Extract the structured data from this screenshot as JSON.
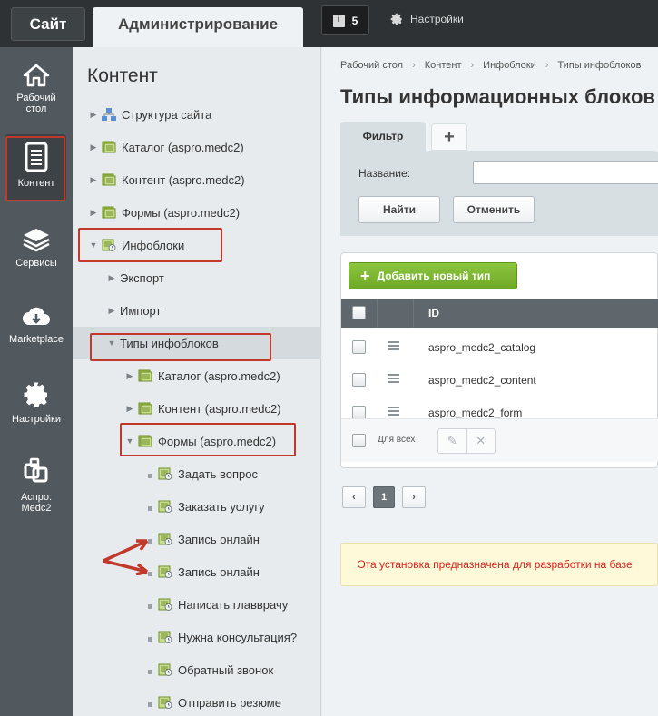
{
  "topbar": {
    "site_label": "Сайт",
    "admin_label": "Администрирование",
    "notifications_count": "5",
    "settings_label": "Настройки"
  },
  "leftnav": {
    "items": [
      {
        "label": "Рабочий стол",
        "icon": "home-icon"
      },
      {
        "label": "Контент",
        "icon": "document-icon",
        "active": true
      },
      {
        "label": "Сервисы",
        "icon": "layers-icon"
      },
      {
        "label": "Marketplace",
        "icon": "cloud-download-icon"
      },
      {
        "label": "Настройки",
        "icon": "gear-icon"
      },
      {
        "label": "Аспро: Medc2",
        "icon": "aspro-logo-icon"
      }
    ]
  },
  "tree": {
    "title": "Контент",
    "rows": [
      {
        "label": "Структура сайта"
      },
      {
        "label": "Каталог (aspro.medc2)"
      },
      {
        "label": "Контент (aspro.medc2)"
      },
      {
        "label": "Формы (aspro.medc2)"
      },
      {
        "label": "Инфоблоки"
      },
      {
        "label": "Экспорт"
      },
      {
        "label": "Импорт"
      },
      {
        "label": "Типы инфоблоков"
      },
      {
        "label": "Каталог (aspro.medc2)"
      },
      {
        "label": "Контент (aspro.medc2)"
      },
      {
        "label": "Формы (aspro.medc2)"
      },
      {
        "label": "Задать вопрос"
      },
      {
        "label": "Заказать услугу"
      },
      {
        "label": "Запись онлайн"
      },
      {
        "label": "Запись онлайн"
      },
      {
        "label": "Написать главврачу"
      },
      {
        "label": "Нужна консультация?"
      },
      {
        "label": "Обратный звонок"
      },
      {
        "label": "Отправить резюме"
      }
    ]
  },
  "main": {
    "breadcrumbs": [
      "Рабочий стол",
      "Контент",
      "Инфоблоки",
      "Типы инфоблоков"
    ],
    "title": "Типы информационных блоков",
    "filter": {
      "tab_label": "Фильтр",
      "name_label": "Название:",
      "name_value": "",
      "find_label": "Найти",
      "cancel_label": "Отменить"
    },
    "add_button_label": "Добавить новый тип",
    "grid": {
      "column_id": "ID",
      "rows": [
        "aspro_medc2_catalog",
        "aspro_medc2_content",
        "aspro_medc2_form"
      ],
      "for_all_label": "Для всех"
    },
    "pager": {
      "current": "1"
    },
    "notice": "Эта установка предназначена для разработки на базе"
  },
  "colors": {
    "annotation_red": "#c0392b",
    "add_green": "#7ab833",
    "notice_text": "#d4241b"
  }
}
